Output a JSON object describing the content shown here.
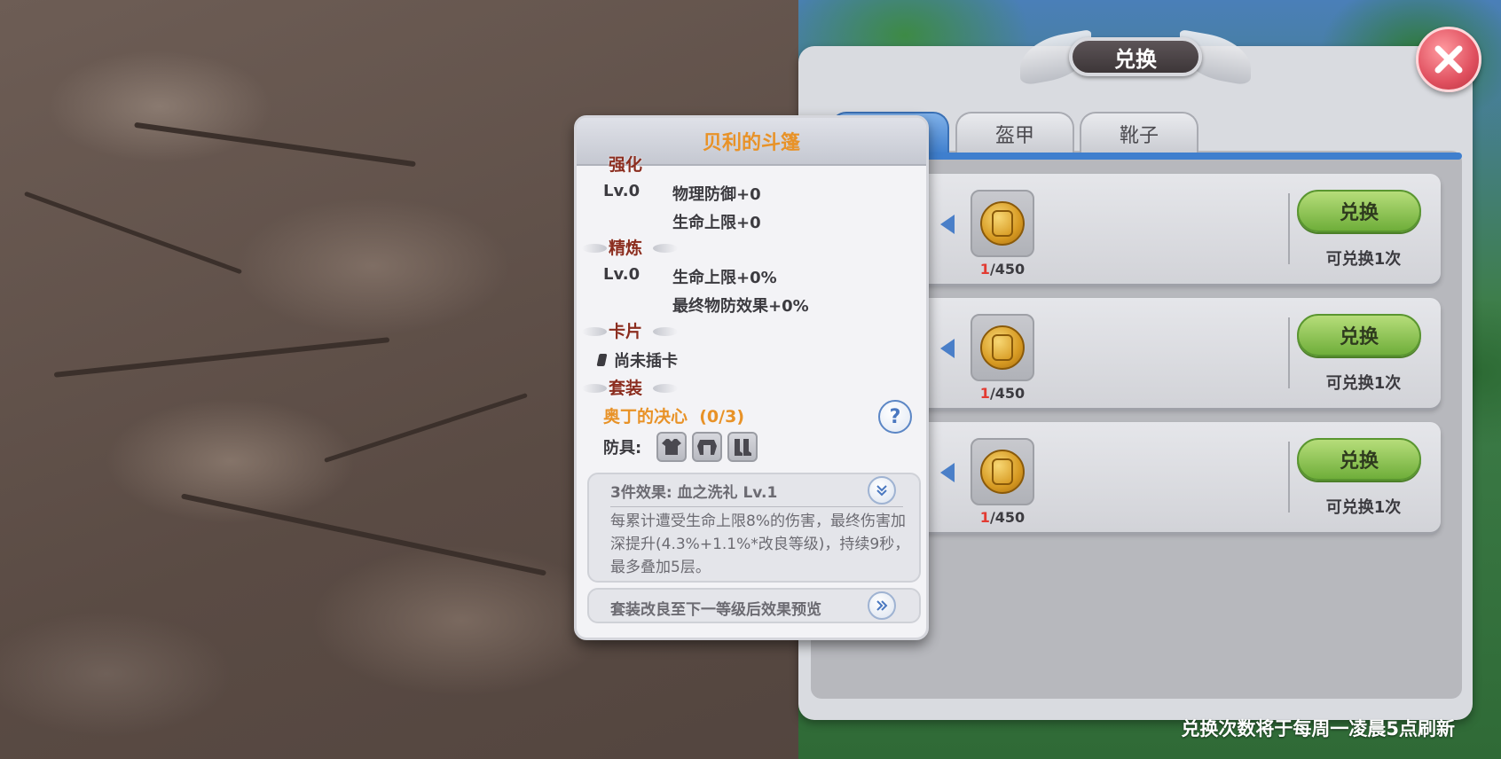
{
  "window": {
    "title": "兑换",
    "tabs": [
      {
        "label": "",
        "active": true
      },
      {
        "label": "盔甲",
        "active": false
      },
      {
        "label": "靴子",
        "active": false
      }
    ],
    "rows": [
      {
        "coin_have": "1",
        "coin_need": "/450",
        "button": "兑换",
        "limit": "可兑换1次"
      },
      {
        "coin_have": "1",
        "coin_need": "/450",
        "button": "兑换",
        "limit": "可兑换1次"
      },
      {
        "coin_have": "1",
        "coin_need": "/450",
        "button": "兑换",
        "limit": "可兑换1次"
      }
    ],
    "refresh_note": "兑换次数将于每周一凌晨5点刷新"
  },
  "tooltip": {
    "title": "贝利的斗篷",
    "strengthen": {
      "label": "强化",
      "level": "Lv.0",
      "stats": [
        "物理防御+0",
        "生命上限+0"
      ]
    },
    "refine": {
      "label": "精炼",
      "level": "Lv.0",
      "stats": [
        "生命上限+0%",
        "最终物防效果+0%"
      ]
    },
    "card": {
      "label": "卡片",
      "value": "尚未插卡"
    },
    "set": {
      "label": "套装",
      "name": "奥丁的决心",
      "count": "(0/3)",
      "armor_label": "防具:",
      "help": "?",
      "effect_title": "3件效果: 血之洗礼 Lv.1",
      "effect_desc": "每累计遭受生命上限8%的伤害，最终伤害加深提升(4.3%+1.1%*改良等级)，持续9秒，最多叠加5层。",
      "preview": "套装改良至下一等级后效果预览"
    }
  },
  "colors": {
    "accent_orange": "#e89227",
    "section_red": "#8b2d1f",
    "exchange_green": "#6fae3a",
    "tab_blue": "#3f7fce",
    "close_red": "#e0505f"
  },
  "icons": [
    "close-icon",
    "coin-icon",
    "arrow-left-icon",
    "help-icon",
    "chevron-down-icon",
    "double-arrow-right-icon",
    "shirt-icon",
    "armor-icon",
    "boots-icon",
    "card-slot-icon"
  ]
}
